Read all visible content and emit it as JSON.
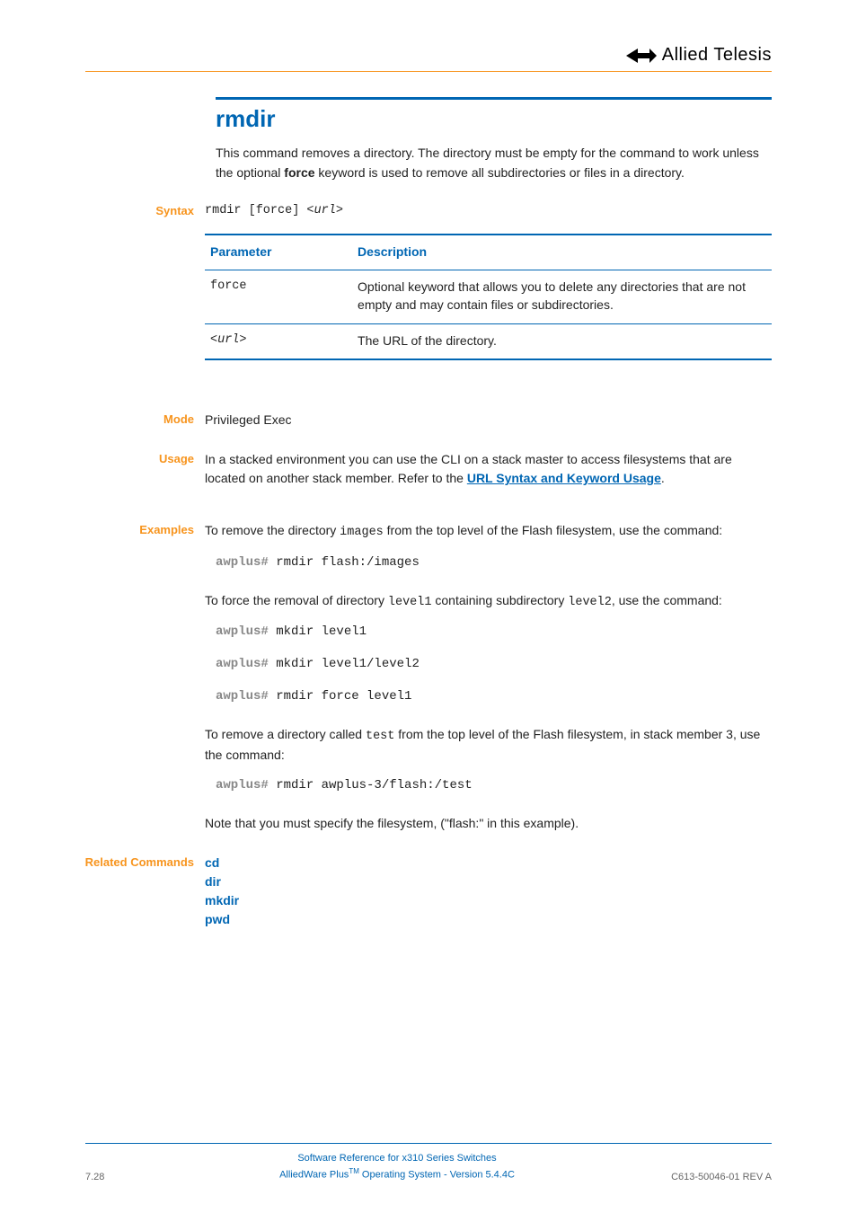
{
  "logo": {
    "mark": "AV",
    "text": "Allied Telesis"
  },
  "title": "rmdir",
  "intro_pre": "This command removes a directory. The directory must be empty for the command to work unless the optional ",
  "intro_bold": "force",
  "intro_post": " keyword is used to remove all subdirectories or files in a directory.",
  "labels": {
    "syntax": "Syntax",
    "mode": "Mode",
    "usage": "Usage",
    "examples": "Examples",
    "related": "Related Commands"
  },
  "syntax": {
    "cmd": "rmdir [force] ",
    "var": "<url>"
  },
  "table": {
    "headers": {
      "param": "Parameter",
      "desc": "Description"
    },
    "rows": [
      {
        "param": "force",
        "desc": "Optional keyword that allows you to delete any directories that are not empty and may contain files or subdirectories."
      },
      {
        "param": "<url>",
        "desc": "The URL of the directory."
      }
    ]
  },
  "mode": "Privileged Exec",
  "usage_pre": "In a stacked environment you can use the CLI on a stack master to access filesystems that are located on another stack member. Refer to the ",
  "usage_link": "URL Syntax and Keyword Usage",
  "usage_post": ".",
  "ex1_pre": "To remove the directory ",
  "ex1_code": "images",
  "ex1_post": " from the top level of the Flash filesystem, use the command:",
  "cmds": {
    "prompt": "awplus#",
    "c1": " rmdir flash:/images",
    "c2a": " mkdir level1",
    "c2b": " mkdir level1/level2",
    "c2c": " rmdir force level1",
    "c3": " rmdir awplus-3/flash:/test"
  },
  "ex2_pre": "To force the removal of directory ",
  "ex2_code1": "level1",
  "ex2_mid": " containing subdirectory ",
  "ex2_code2": "level2",
  "ex2_post": ", use the command:",
  "ex3_pre": "To remove a directory called ",
  "ex3_code": "test",
  "ex3_post": " from the top level of the Flash filesystem, in stack member 3, use the command:",
  "note": "Note that you must specify the filesystem, (\"flash:\" in this example).",
  "related": [
    "cd",
    "dir",
    "mkdir",
    "pwd"
  ],
  "footer": {
    "left": "7.28",
    "line1": "Software Reference for x310 Series Switches",
    "line2a": "AlliedWare Plus",
    "line2tm": "TM",
    "line2b": " Operating System  - Version 5.4.4C",
    "right": "C613-50046-01 REV A"
  }
}
